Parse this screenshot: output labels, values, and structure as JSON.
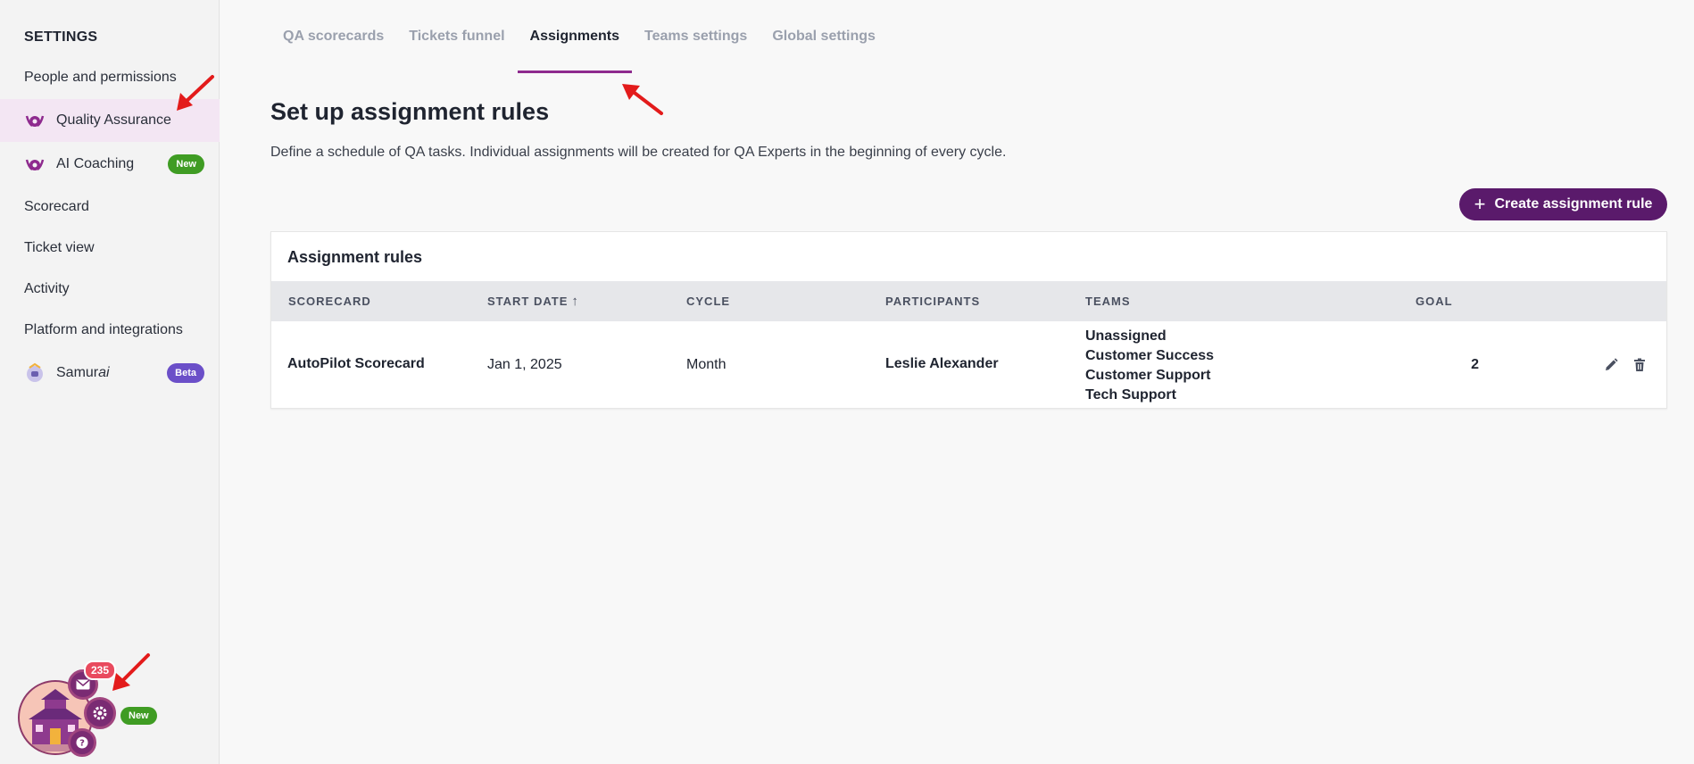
{
  "sidebar": {
    "heading": "SETTINGS",
    "items": [
      {
        "label": "People and permissions"
      },
      {
        "label": "Quality Assurance"
      },
      {
        "label": "AI Coaching",
        "badge": "New"
      },
      {
        "label": "Scorecard"
      },
      {
        "label": "Ticket view"
      },
      {
        "label": "Activity"
      },
      {
        "label": "Platform and integrations"
      },
      {
        "label_main": "Samur",
        "label_italic": "ai",
        "badge": "Beta"
      }
    ]
  },
  "widget": {
    "mail_count": "235",
    "badge": "New",
    "icons": [
      "castle-avatar",
      "mail-icon",
      "gear-icon",
      "help-icon"
    ]
  },
  "tabs": [
    {
      "label": "QA scorecards"
    },
    {
      "label": "Tickets funnel"
    },
    {
      "label": "Assignments",
      "active": true
    },
    {
      "label": "Teams settings"
    },
    {
      "label": "Global settings"
    }
  ],
  "page": {
    "title": "Set up assignment rules",
    "description": "Define a schedule of QA tasks. Individual assignments will be created for QA Experts in the beginning of every cycle.",
    "create_button": "Create assignment rule"
  },
  "table": {
    "title": "Assignment rules",
    "columns": [
      "SCORECARD",
      "START DATE",
      "CYCLE",
      "PARTICIPANTS",
      "TEAMS",
      "GOAL"
    ],
    "sort_indicator": "↑",
    "rows": [
      {
        "scorecard": "AutoPilot Scorecard",
        "start_date": "Jan 1, 2025",
        "cycle": "Month",
        "participants": "Leslie Alexander",
        "teams": [
          "Unassigned",
          "Customer Success",
          "Customer Support",
          "Tech Support"
        ],
        "goal": "2"
      }
    ]
  },
  "colors": {
    "accent": "#8e2a8e",
    "button": "#5a1a6b",
    "badge_new": "#3f9c23",
    "badge_beta": "#6b4fc8",
    "annotation_arrow": "#e31b1b"
  }
}
